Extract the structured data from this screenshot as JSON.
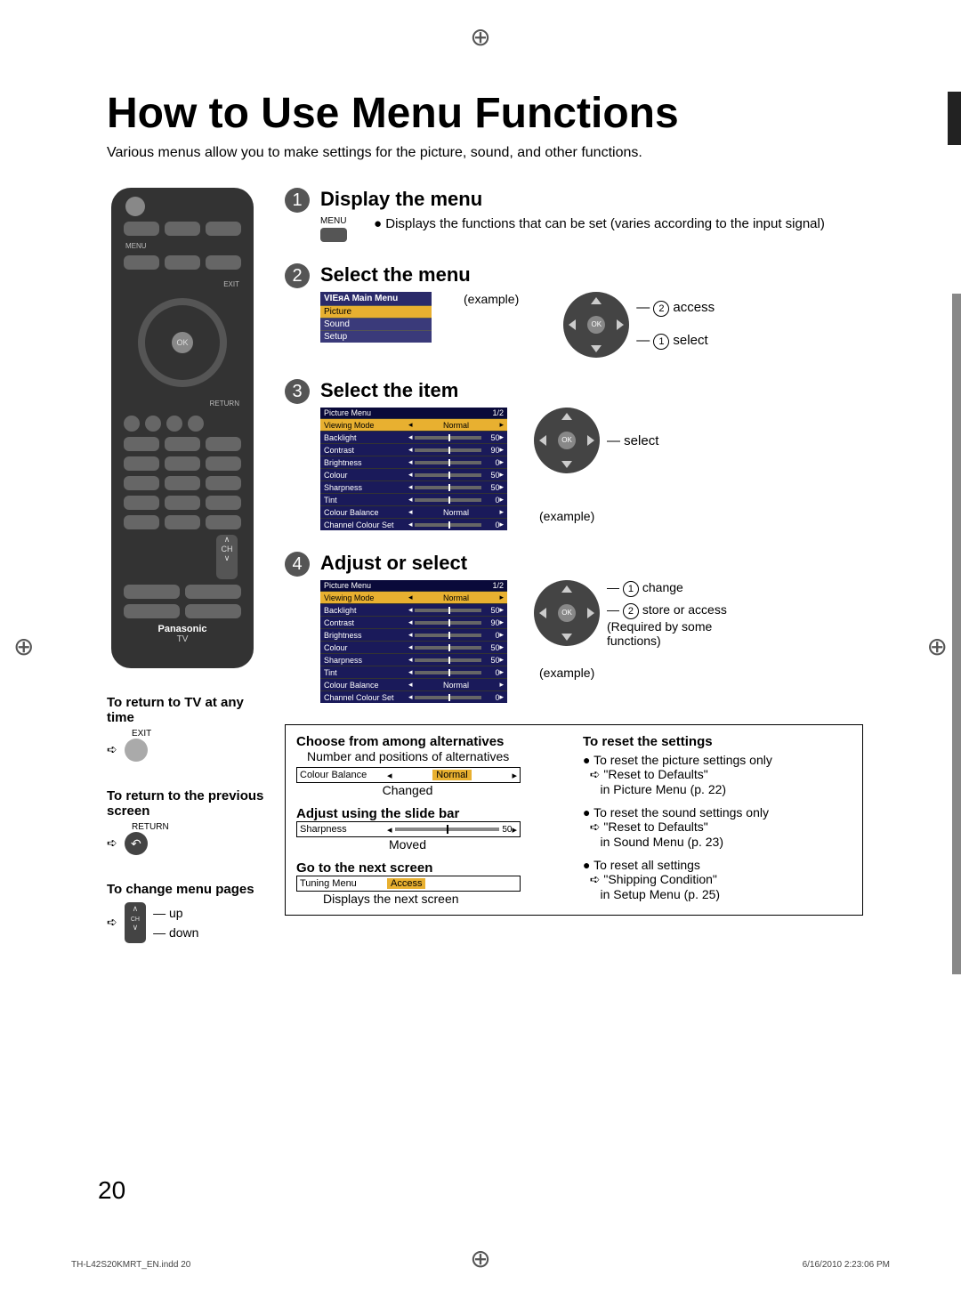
{
  "title": "How to Use Menu Functions",
  "intro": "Various menus allow you to make settings for the picture, sound, and other functions.",
  "remote": {
    "menu_label": "MENU",
    "exit_label": "EXIT",
    "ok": "OK",
    "return": "RETURN",
    "ch": "CH",
    "brand": "Panasonic",
    "tv": "TV"
  },
  "steps": {
    "s1": {
      "n": "1",
      "title": "Display the menu",
      "btn_label": "MENU",
      "desc": "Displays the functions that can be set (varies according to the input signal)"
    },
    "s2": {
      "n": "2",
      "title": "Select the menu",
      "menu_hdr": "VIEᴙA Main Menu",
      "items": [
        "Picture",
        "Sound",
        "Setup"
      ],
      "example": "(example)",
      "nav_access": "access",
      "nav_select": "select",
      "c1": "1",
      "c2": "2",
      "ok": "OK"
    },
    "s3": {
      "n": "3",
      "title": "Select the item",
      "hdr": "Picture Menu",
      "page": "1/2",
      "example": "(example)",
      "nav_select": "select",
      "ok": "OK",
      "rows": [
        {
          "l": "Viewing Mode",
          "v": "Normal",
          "sel": true,
          "num": ""
        },
        {
          "l": "Backlight",
          "v": "",
          "num": "50"
        },
        {
          "l": "Contrast",
          "v": "",
          "num": "90"
        },
        {
          "l": "Brightness",
          "v": "",
          "num": "0"
        },
        {
          "l": "Colour",
          "v": "",
          "num": "50"
        },
        {
          "l": "Sharpness",
          "v": "",
          "num": "50"
        },
        {
          "l": "Tint",
          "v": "",
          "num": "0"
        },
        {
          "l": "Colour Balance",
          "v": "Normal",
          "num": ""
        },
        {
          "l": "Channel Colour Set",
          "v": "",
          "num": "0"
        }
      ]
    },
    "s4": {
      "n": "4",
      "title": "Adjust or select",
      "hdr": "Picture Menu",
      "page": "1/2",
      "example": "(example)",
      "ok": "OK",
      "c1": "1",
      "c2": "2",
      "nav_change": "change",
      "nav_store": "store or access (Required by some functions)",
      "rows": [
        {
          "l": "Viewing Mode",
          "v": "Normal",
          "sel": true,
          "num": ""
        },
        {
          "l": "Backlight",
          "v": "",
          "num": "50",
          "sel2": true
        },
        {
          "l": "Contrast",
          "v": "",
          "num": "90"
        },
        {
          "l": "Brightness",
          "v": "",
          "num": "0"
        },
        {
          "l": "Colour",
          "v": "",
          "num": "50"
        },
        {
          "l": "Sharpness",
          "v": "",
          "num": "50"
        },
        {
          "l": "Tint",
          "v": "",
          "num": "0"
        },
        {
          "l": "Colour Balance",
          "v": "Normal",
          "num": ""
        },
        {
          "l": "Channel Colour Set",
          "v": "",
          "num": "0"
        }
      ]
    }
  },
  "box": {
    "h1": "Choose from among alternatives",
    "h1desc": "Number and positions of alternatives",
    "row1_l": "Colour Balance",
    "row1_v": "Normal",
    "row1_cap": "Changed",
    "h2": "Adjust using the slide bar",
    "row2_l": "Sharpness",
    "row2_v": "50",
    "row2_cap": "Moved",
    "h3": "Go to the next screen",
    "row3_l": "Tuning Menu",
    "row3_v": "Access",
    "row3_cap": "Displays the next screen",
    "rh": "To reset the settings",
    "r1": "To reset the picture settings only",
    "r1a": "\"Reset to Defaults\"",
    "r1b": "in Picture Menu (p. 22)",
    "r2": "To reset the sound settings only",
    "r2a": "\"Reset to Defaults\"",
    "r2b": "in Sound Menu (p. 23)",
    "r3": "To reset all settings",
    "r3a": "\"Shipping Condition\"",
    "r3b": "in Setup Menu (p. 25)"
  },
  "side": {
    "b1": "To return to TV at any time",
    "b1_lbl": "EXIT",
    "b2": "To return to the previous screen",
    "b2_lbl": "RETURN",
    "b3": "To change menu pages",
    "b3_up": "up",
    "b3_dn": "down",
    "b3_ch": "CH"
  },
  "pagenum": "20",
  "footerL": "TH-L42S20KMRT_EN.indd   20",
  "footerR": "6/16/2010   2:23:06 PM"
}
